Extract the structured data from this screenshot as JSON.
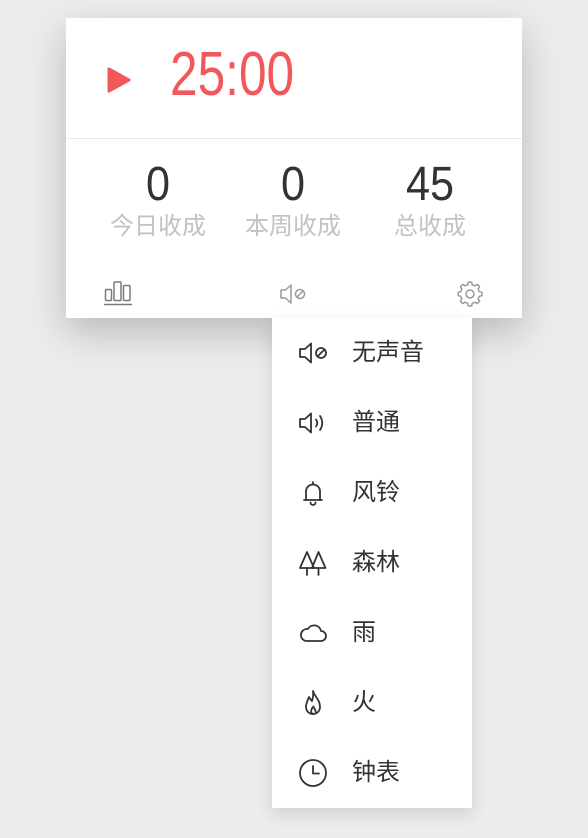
{
  "timer": {
    "time": "25:00",
    "control_icon": "play-icon"
  },
  "stats": [
    {
      "value": "0",
      "label": "今日收成"
    },
    {
      "value": "0",
      "label": "本周收成"
    },
    {
      "value": "45",
      "label": "总收成"
    }
  ],
  "toolbar": {
    "buttons": [
      {
        "icon": "bar-chart-icon"
      },
      {
        "icon": "sound-mute-icon"
      },
      {
        "icon": "gear-icon"
      }
    ]
  },
  "sound_menu": {
    "items": [
      {
        "label": "无声音",
        "icon": "sound-mute-icon"
      },
      {
        "label": "普通",
        "icon": "speaker-icon"
      },
      {
        "label": "风铃",
        "icon": "bell-icon"
      },
      {
        "label": "森林",
        "icon": "trees-icon"
      },
      {
        "label": "雨",
        "icon": "cloud-icon"
      },
      {
        "label": "火",
        "icon": "flame-icon"
      },
      {
        "label": "钟表",
        "icon": "clock-icon"
      }
    ]
  },
  "colors": {
    "accent": "#f2585a",
    "text": "#333333",
    "muted_text": "#c2c2c2",
    "background": "#ececec",
    "surface": "#ffffff"
  }
}
